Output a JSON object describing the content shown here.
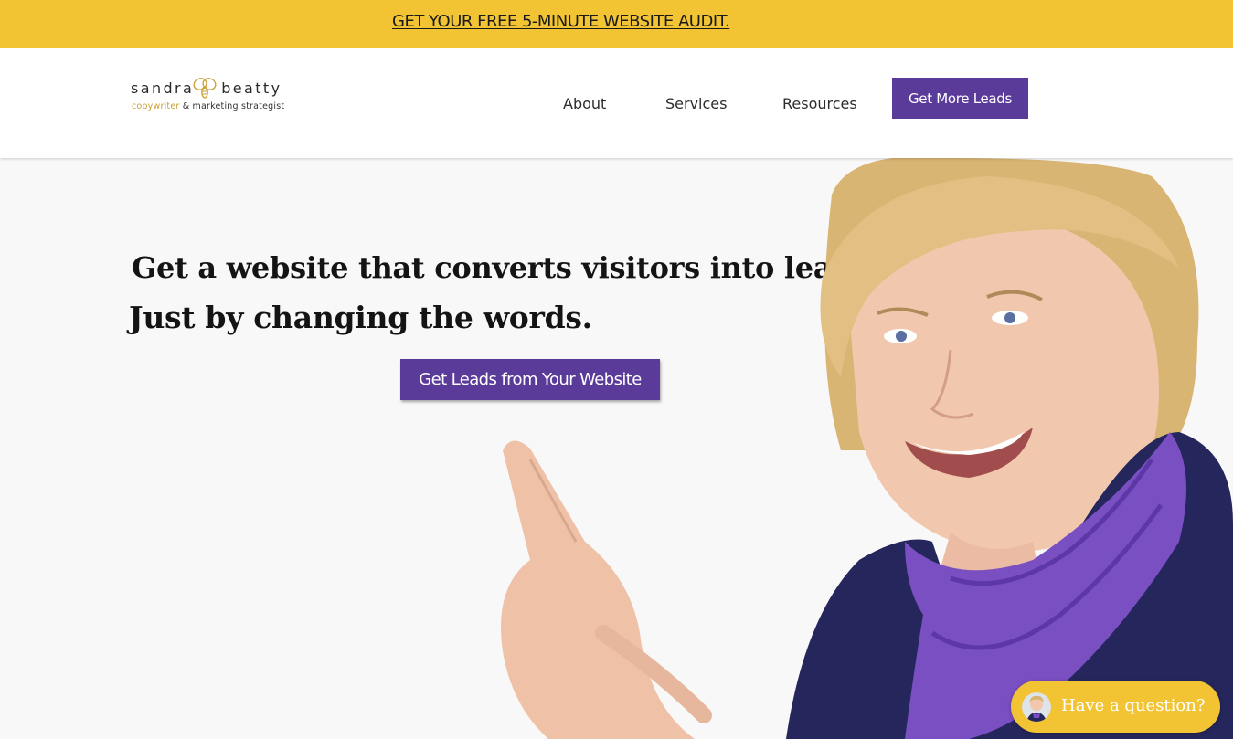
{
  "promo": {
    "link_text": "GET YOUR FREE 5-MINUTE WEBSITE AUDIT."
  },
  "header": {
    "logo": {
      "first_name": "sandra",
      "last_name": "beatty",
      "tagline_gold": "copywriter",
      "tagline_rest": "& marketing strategist"
    },
    "nav": [
      {
        "label": "About"
      },
      {
        "label": "Services"
      },
      {
        "label": "Resources"
      }
    ],
    "cta_label": "Get More Leads"
  },
  "hero": {
    "headline_line1": "Get a website that converts visitors into leads.",
    "headline_line2": "Just by changing the words.",
    "cta_label": "Get Leads from Your Website",
    "photo": "woman-pointing-photo"
  },
  "chat": {
    "label": "Have a question?",
    "icon": "chat-avatar-icon"
  },
  "colors": {
    "accent_yellow": "#f2c433",
    "brand_purple": "#5b3b99",
    "logo_gold": "#c9a036",
    "background": "#f8f8f8"
  }
}
